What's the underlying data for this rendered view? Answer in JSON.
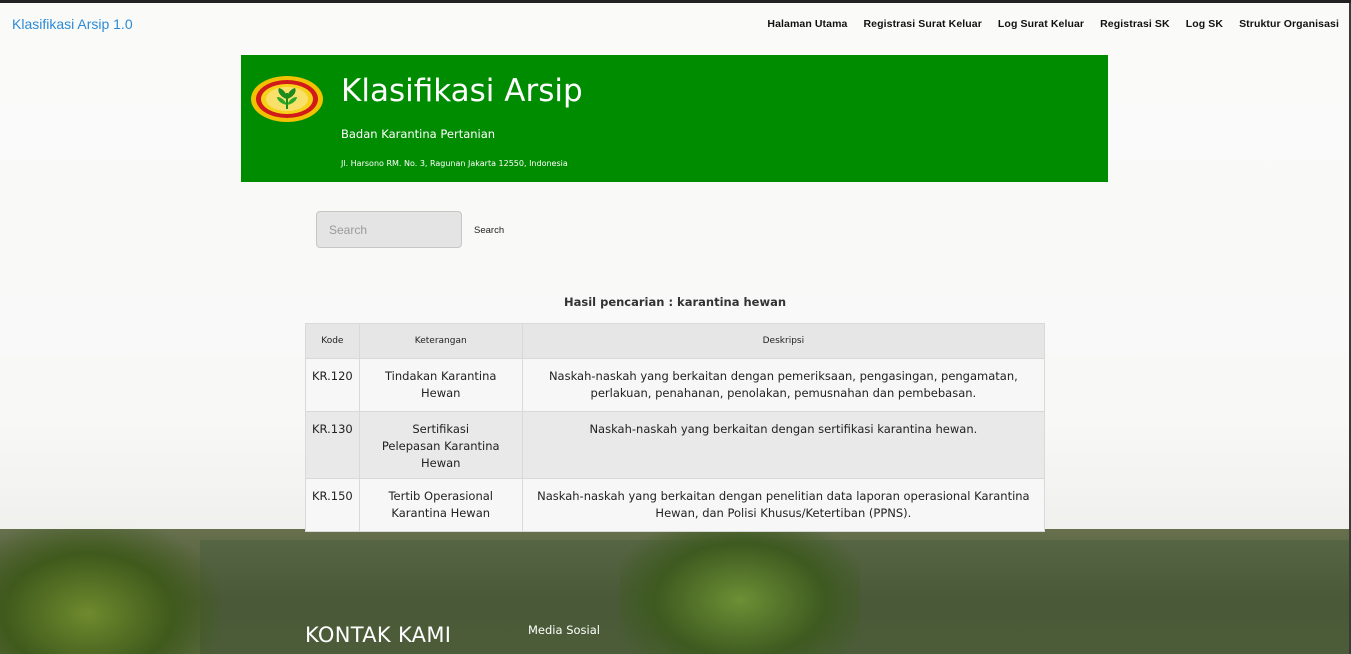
{
  "app": {
    "brand": "Klasifikasi Arsip 1.0"
  },
  "nav": {
    "items": [
      {
        "label": "Halaman Utama"
      },
      {
        "label": "Registrasi Surat Keluar"
      },
      {
        "label": "Log Surat Keluar"
      },
      {
        "label": "Registrasi SK"
      },
      {
        "label": "Log SK"
      },
      {
        "label": "Struktur Organisasi"
      }
    ]
  },
  "banner": {
    "title": "Klasifikasi Arsip",
    "subtitle": "Badan Karantina Pertanian",
    "address": "Jl. Harsono RM. No. 3, Ragunan Jakarta 12550, Indonesia",
    "logo_icon": "ministry-emblem-icon",
    "background_color": "#008c00"
  },
  "search": {
    "placeholder": "Search",
    "value": "",
    "button_label": "Search"
  },
  "results": {
    "heading": "Hasil pencarian : karantina hewan",
    "columns": [
      "Kode",
      "Keterangan",
      "Deskripsi"
    ],
    "rows": [
      {
        "kode": "KR.120",
        "keterangan": "Tindakan Karantina Hewan",
        "deskripsi": "Naskah-naskah yang berkaitan dengan pemeriksaan, pengasingan, pengamatan, perlakuan, penahanan, penolakan, pemusnahan dan pembebasan."
      },
      {
        "kode": "KR.130",
        "keterangan": "Sertifikasi Pelepasan Karantina Hewan",
        "deskripsi": "Naskah-naskah yang berkaitan dengan sertifikasi karantina hewan."
      },
      {
        "kode": "KR.150",
        "keterangan": "Tertib Operasional Karantina Hewan",
        "deskripsi": "Naskah-naskah yang berkaitan dengan penelitian data laporan operasional Karantina Hewan, dan Polisi Khusus/Ketertiban (PPNS)."
      }
    ]
  },
  "footer": {
    "contact_title": "KONTAK KAMI",
    "social_label": "Media Sosial"
  }
}
